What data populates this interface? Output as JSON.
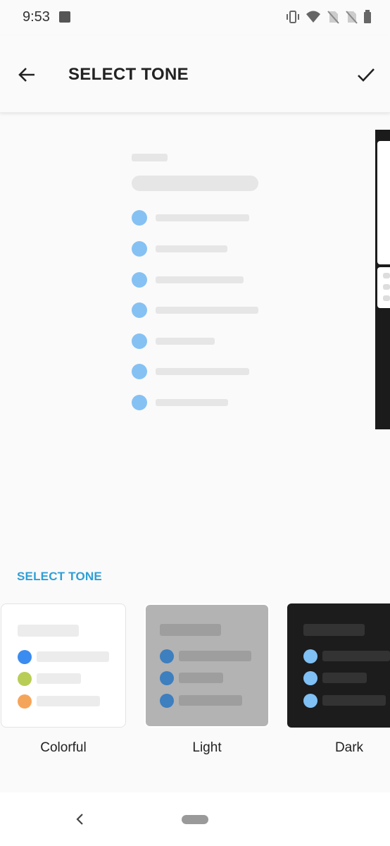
{
  "status_bar": {
    "time": "9:53",
    "icons": [
      "image-icon",
      "vibrate-icon",
      "wifi-icon",
      "no-sim-icon",
      "no-sim-icon",
      "battery-icon"
    ]
  },
  "app_bar": {
    "title": "SELECT TONE",
    "back_icon": "arrow-left-icon",
    "confirm_icon": "check-icon"
  },
  "section": {
    "label": "SELECT TONE"
  },
  "tones": [
    {
      "label": "Colorful",
      "selected": true,
      "dot_colors": [
        "#3b8cf0",
        "#b8cd55",
        "#f5a55a"
      ],
      "background": "#ffffff"
    },
    {
      "label": "Light",
      "selected": false,
      "dot_colors": [
        "#3d7fbf",
        "#3d7fbf",
        "#3d7fbf"
      ],
      "background": "#b3b3b3"
    },
    {
      "label": "Dark",
      "selected": false,
      "dot_colors": [
        "#7fc0f5",
        "#7fc0f5",
        "#7fc0f5"
      ],
      "background": "#1c1c1c"
    }
  ],
  "preview": {
    "accent": "#86c1f3",
    "rows": 7
  },
  "colors": {
    "accent": "#2f9fd6"
  },
  "nav_bar": {
    "back_icon": "nav-back-icon",
    "home_icon": "nav-home-pill"
  }
}
